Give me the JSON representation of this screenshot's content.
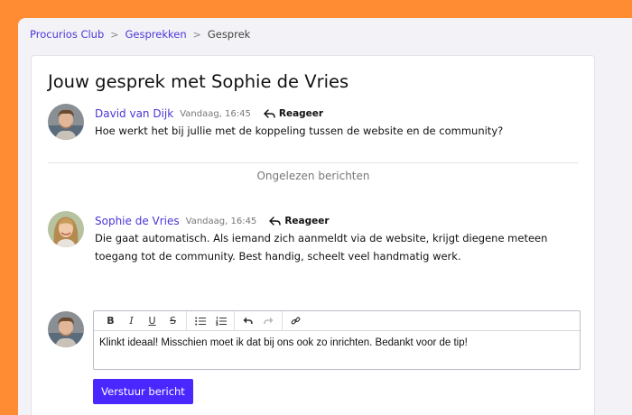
{
  "breadcrumb": {
    "items": [
      "Procurios Club",
      "Gesprekken",
      "Gesprek"
    ],
    "separator": ">"
  },
  "title": "Jouw gesprek met Sophie de Vries",
  "messages": [
    {
      "author": "David van Dijk",
      "time": "Vandaag, 16:45",
      "reply_label": "Reageer",
      "text": "Hoe werkt het bij jullie met de koppeling tussen de website en de community?"
    },
    {
      "author": "Sophie de Vries",
      "time": "Vandaag, 16:45",
      "reply_label": "Reageer",
      "text": "Die gaat automatisch. Als iemand zich aanmeldt via de website, krijgt diegene meteen toegang tot de community. Best handig, scheelt veel handmatig werk."
    }
  ],
  "unread_label": "Ongelezen berichten",
  "editor": {
    "toolbar": {
      "bold": "B",
      "italic": "I",
      "underline": "U",
      "strike": "S",
      "icons": [
        "bullet-list-icon",
        "numbered-list-icon",
        "undo-icon",
        "redo-icon",
        "link-icon"
      ]
    },
    "text": "Klinkt ideaal! Misschien moet ik dat bij ons ook zo inrichten. Bedankt voor de tip!"
  },
  "send_label": "Verstuur bericht",
  "colors": {
    "background": "#ff8c33",
    "accent": "#4a26ff",
    "link": "#4a36d8"
  }
}
